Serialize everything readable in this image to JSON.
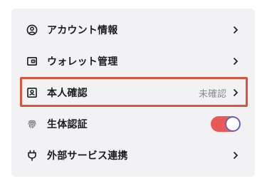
{
  "settings": {
    "items": [
      {
        "label": "アカウント情報",
        "icon": "account-circle-icon",
        "value": ""
      },
      {
        "label": "ウォレット管理",
        "icon": "wallet-icon",
        "value": ""
      },
      {
        "label": "本人確認",
        "icon": "id-badge-icon",
        "value": "未確認"
      },
      {
        "label": "生体認証",
        "icon": "fingerprint-icon",
        "value": ""
      },
      {
        "label": "外部サービス連携",
        "icon": "plug-icon",
        "value": ""
      }
    ],
    "biometric_enabled": true,
    "toggle_color": "#e85a5a",
    "highlight_color": "#d9543f"
  }
}
